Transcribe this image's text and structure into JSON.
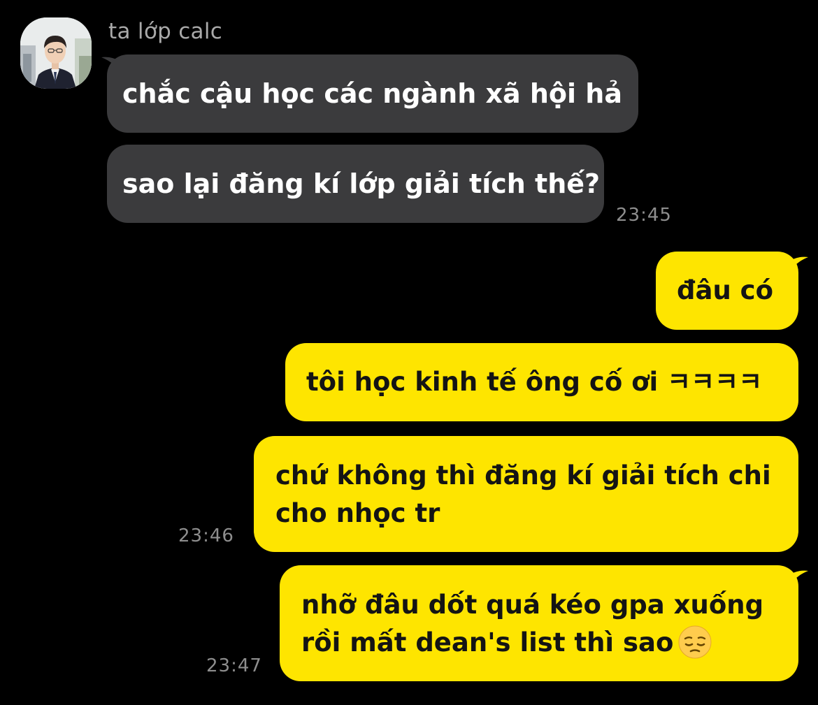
{
  "contact": {
    "name": "ta lớp calc"
  },
  "messages": {
    "in1": "chắc cậu học các ngành xã hội hả",
    "in2": "sao lại đăng kí lớp giải tích thế?",
    "out1": "đâu có",
    "out2": "tôi học kinh tế ông cố ơi ㅋㅋㅋㅋ",
    "out3_line1": "chứ không thì đăng kí giải tích chi",
    "out3_line2": "cho nhọc tr",
    "out4_line1": "nhỡ đâu dốt quá kéo gpa xuống",
    "out4_line2": "rồi mất dean's list thì sao",
    "out4_emoji": "pensive-face"
  },
  "times": {
    "t1": "23:45",
    "t2": "23:46",
    "t3": "23:47"
  },
  "colors": {
    "background": "#000000",
    "incoming_bubble": "#3b3b3d",
    "outgoing_bubble": "#fee500",
    "timestamp": "#8e8e8e",
    "sender_name": "#a9a9a9"
  }
}
